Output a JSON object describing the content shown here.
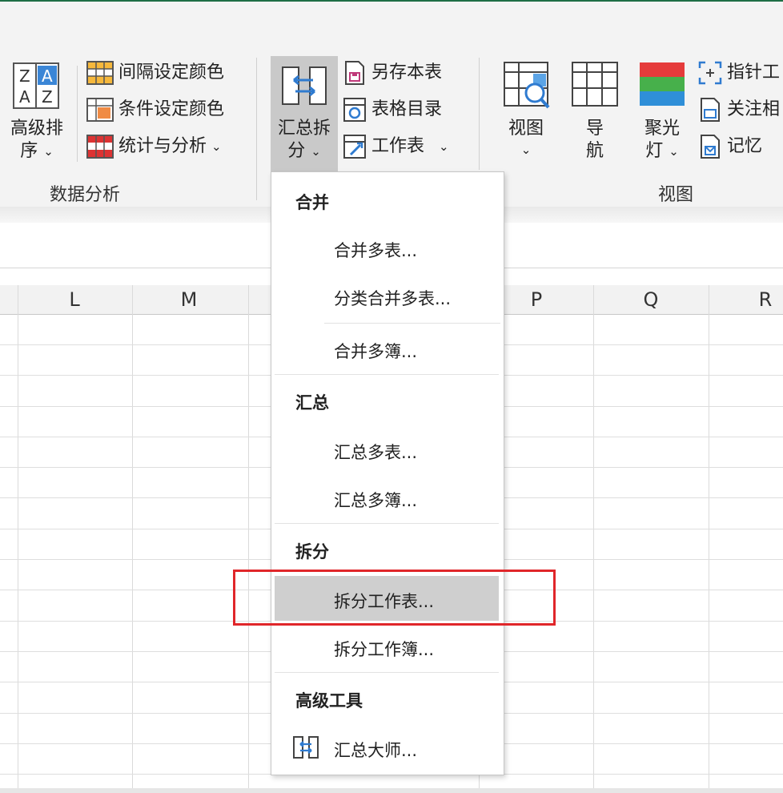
{
  "ribbon": {
    "advanced_sort": {
      "line1": "高级排",
      "line2": "序"
    },
    "interval_color": "间隔设定颜色",
    "condition_color": "条件设定颜色",
    "stats_analysis": "统计与分析",
    "group_data_analysis": "数据分析",
    "summary_split": {
      "line1": "汇总拆",
      "line2": "分"
    },
    "save_sheet": "另存本表",
    "table_toc": "表格目录",
    "worksheet": "工作表",
    "view": "视图",
    "nav": {
      "line1": "导",
      "line2": "航"
    },
    "spotlight": {
      "line1": "聚光",
      "line2": "灯"
    },
    "pointer": "指针工",
    "focus": "关注相",
    "memory": "记忆",
    "group_view": "视图"
  },
  "columns": [
    "L",
    "M",
    "P",
    "Q",
    "R"
  ],
  "menu": {
    "sections": [
      {
        "header": "合并",
        "items": [
          "合并多表...",
          "分类合并多表...",
          "合并多簿..."
        ]
      },
      {
        "header": "汇总",
        "items": [
          "汇总多表...",
          "汇总多簿..."
        ]
      },
      {
        "header": "拆分",
        "items": [
          "拆分工作表...",
          "拆分工作簿..."
        ]
      },
      {
        "header": "高级工具",
        "items": [
          "汇总大师..."
        ]
      }
    ],
    "highlighted_item": "拆分工作表..."
  },
  "colors": {
    "highlight_border": "#e0262a",
    "accent_green": "#1e6e45"
  }
}
